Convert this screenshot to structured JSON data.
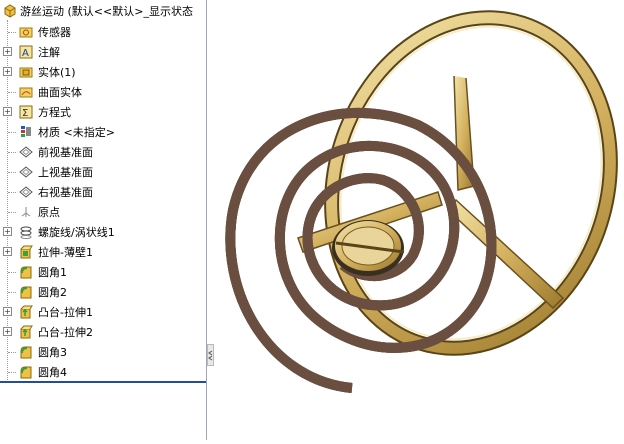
{
  "tree": {
    "root": {
      "label": "游丝运动  (默认<<默认>_显示状态",
      "icon": "part-icon"
    },
    "items": [
      {
        "label": "传感器",
        "icon": "sensor-folder-icon",
        "expandable": false
      },
      {
        "label": "注解",
        "icon": "annotation-icon",
        "expandable": true
      },
      {
        "label": "实体(1)",
        "icon": "solid-bodies-folder-icon",
        "expandable": true
      },
      {
        "label": "曲面实体",
        "icon": "surface-bodies-folder-icon",
        "expandable": false
      },
      {
        "label": "方程式",
        "icon": "equations-icon",
        "expandable": true
      },
      {
        "label": "材质 <未指定>",
        "icon": "material-icon",
        "expandable": false
      },
      {
        "label": "前视基准面",
        "icon": "plane-icon",
        "expandable": false
      },
      {
        "label": "上视基准面",
        "icon": "plane-icon",
        "expandable": false
      },
      {
        "label": "右视基准面",
        "icon": "plane-icon",
        "expandable": false
      },
      {
        "label": "原点",
        "icon": "origin-icon",
        "expandable": false
      },
      {
        "label": "螺旋线/涡状线1",
        "icon": "helix-icon",
        "expandable": true
      },
      {
        "label": "拉伸-薄壁1",
        "icon": "extrude-icon",
        "expandable": true
      },
      {
        "label": "圆角1",
        "icon": "fillet-icon",
        "expandable": false
      },
      {
        "label": "圆角2",
        "icon": "fillet-icon",
        "expandable": false
      },
      {
        "label": "凸台-拉伸1",
        "icon": "boss-extrude-icon",
        "expandable": true
      },
      {
        "label": "凸台-拉伸2",
        "icon": "boss-extrude-icon",
        "expandable": true
      },
      {
        "label": "圆角3",
        "icon": "fillet-icon",
        "expandable": false
      },
      {
        "label": "圆角4",
        "icon": "fillet-icon",
        "expandable": false
      }
    ]
  },
  "colors": {
    "brass": "#d9b860",
    "brass_dark": "#8a6a20",
    "spring_pink": "#c89a8e",
    "selection_line": "#1f4e9c"
  }
}
